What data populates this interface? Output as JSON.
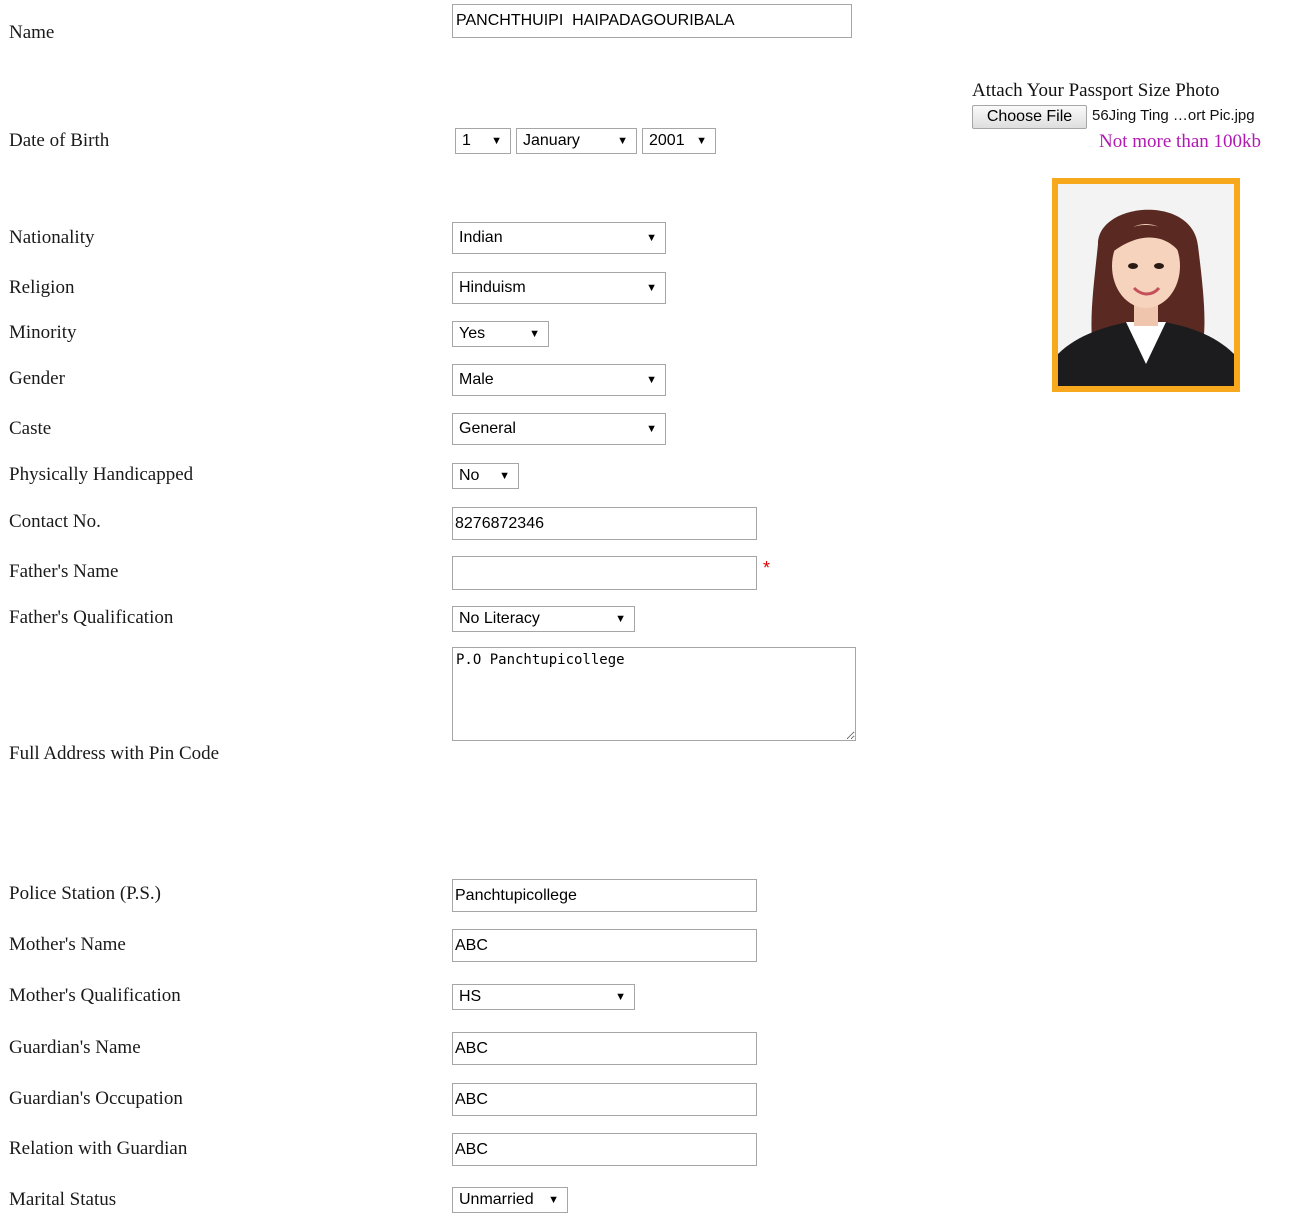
{
  "form": {
    "name_label": "Name",
    "name_value": "PANCHTHUIPI  HAIPADAGOURIBALA",
    "dob_label": "Date of Birth",
    "dob_day": "1",
    "dob_month": "January",
    "dob_year": "2001",
    "nationality_label": "Nationality",
    "nationality_value": "Indian",
    "religion_label": "Religion",
    "religion_value": "Hinduism",
    "minority_label": "Minority",
    "minority_value": "Yes",
    "gender_label": "Gender",
    "gender_value": "Male",
    "caste_label": "Caste",
    "caste_value": "General",
    "handicapped_label": "Physically Handicapped",
    "handicapped_value": "No",
    "contact_label": "Contact No.",
    "contact_value": "8276872346",
    "father_name_label": "Father's Name",
    "father_name_value": "",
    "required_mark": "*",
    "father_qual_label": "Father's Qualification",
    "father_qual_value": "No Literacy",
    "address_label": "Full Address with Pin Code",
    "address_value": "P.O Panchtupicollege",
    "police_label": "Police Station (P.S.)",
    "police_value": "Panchtupicollege",
    "mother_name_label": "Mother's Name",
    "mother_name_value": "ABC",
    "mother_qual_label": "Mother's Qualification",
    "mother_qual_value": "HS",
    "guardian_name_label": "Guardian's Name",
    "guardian_name_value": "ABC",
    "guardian_occ_label": "Guardian's Occupation",
    "guardian_occ_value": "ABC",
    "relation_label": "Relation with Guardian",
    "relation_value": "ABC",
    "marital_label": "Marital Status",
    "marital_value": "Unmarried"
  },
  "photo": {
    "label": "Attach Your Passport Size Photo",
    "button_label": "Choose File",
    "file_name": "56Jing Ting …ort Pic.jpg",
    "size_note": "Not more than 100kb",
    "note_color": "#b01ab0",
    "frame_color": "#f7a81d"
  },
  "icons": {
    "dropdown_arrow": "▼"
  }
}
